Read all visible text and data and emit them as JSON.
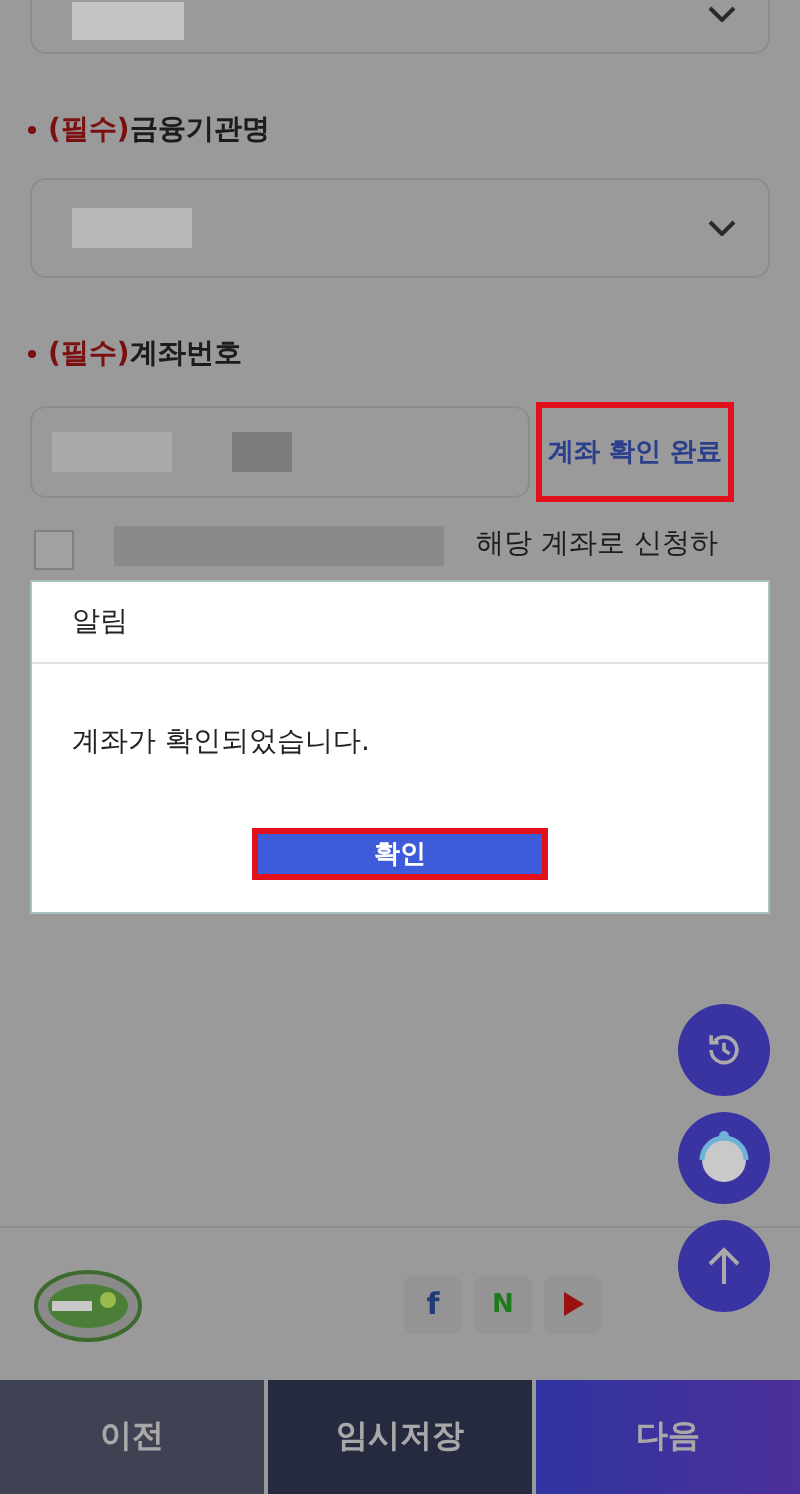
{
  "fields": [
    {
      "kind": "select",
      "masked": true
    },
    {
      "kind": "select",
      "required_tag": "(필수)",
      "label": "금융기관명",
      "masked": true
    },
    {
      "kind": "input",
      "required_tag": "(필수)",
      "label": "계좌번호",
      "masked": true,
      "action": {
        "label": "계좌 확인 완료",
        "highlighted": true
      }
    }
  ],
  "agreement": {
    "checked": false,
    "masked": true,
    "text": "해당 계좌로 신청하"
  },
  "dialog": {
    "title": "알림",
    "message": "계좌가 확인되었습니다.",
    "button": {
      "label": "확인",
      "highlighted": true
    }
  },
  "floating_buttons": [
    {
      "kind": "history"
    },
    {
      "kind": "chatbot"
    },
    {
      "kind": "top"
    }
  ],
  "footer": {
    "social": [
      {
        "kind": "facebook",
        "label": "f"
      },
      {
        "kind": "naver",
        "label": "N"
      },
      {
        "kind": "youtube"
      }
    ]
  },
  "bottom_bar": [
    {
      "kind": "prev",
      "label": "이전"
    },
    {
      "kind": "save",
      "label": "임시저장"
    },
    {
      "kind": "next",
      "label": "다음"
    }
  ]
}
